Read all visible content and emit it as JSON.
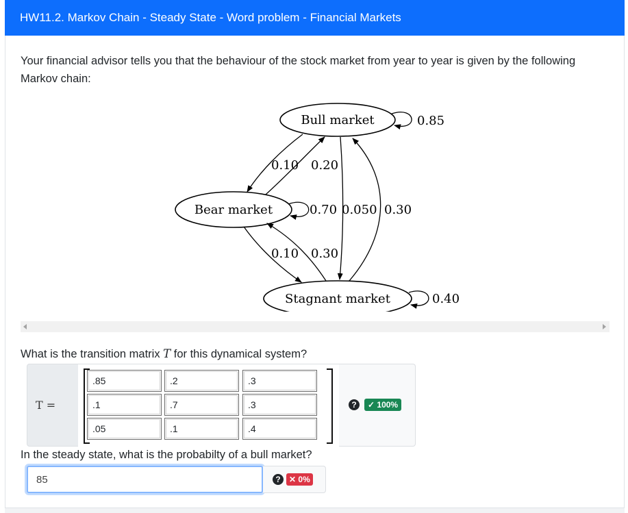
{
  "header": {
    "title": "HW11.2. Markov Chain - Steady State - Word problem - Financial Markets"
  },
  "intro": {
    "text": "Your financial advisor tells you that the behaviour of the stock market from year to year is given by the following Markov chain:"
  },
  "graph": {
    "nodes": {
      "bull": "Bull market",
      "bear": "Bear market",
      "stagnant": "Stagnant market"
    },
    "edges": {
      "bull_self": "0.85",
      "bull_to_bear": "0.10",
      "bear_to_bull": "0.20",
      "bear_self": "0.70",
      "bull_to_stag": "0.050",
      "stag_to_bull": "0.30",
      "bear_to_stag": "0.10",
      "stag_to_bear": "0.30",
      "stag_self": "0.40"
    }
  },
  "question1": {
    "prefix": "What is the transition matrix ",
    "var": "T",
    "suffix": " for this dynamical system?"
  },
  "matrix": {
    "label": "T =",
    "rows": [
      [
        ".85",
        ".2",
        ".3"
      ],
      [
        ".1",
        ".7",
        ".3"
      ],
      [
        ".05",
        ".1",
        ".4"
      ]
    ],
    "badge": "✓ 100%"
  },
  "question2": {
    "text": "In the steady state, what is the probabilty of a bull market?"
  },
  "answer": {
    "value": "85",
    "badge": "✕ 0%"
  },
  "icons": {
    "help": "question-circle-icon",
    "check": "check-icon",
    "cross": "x-icon"
  },
  "colors": {
    "header": "#0d6efd",
    "success": "#198754",
    "danger": "#dc3545",
    "focus": "#86b7fe"
  }
}
